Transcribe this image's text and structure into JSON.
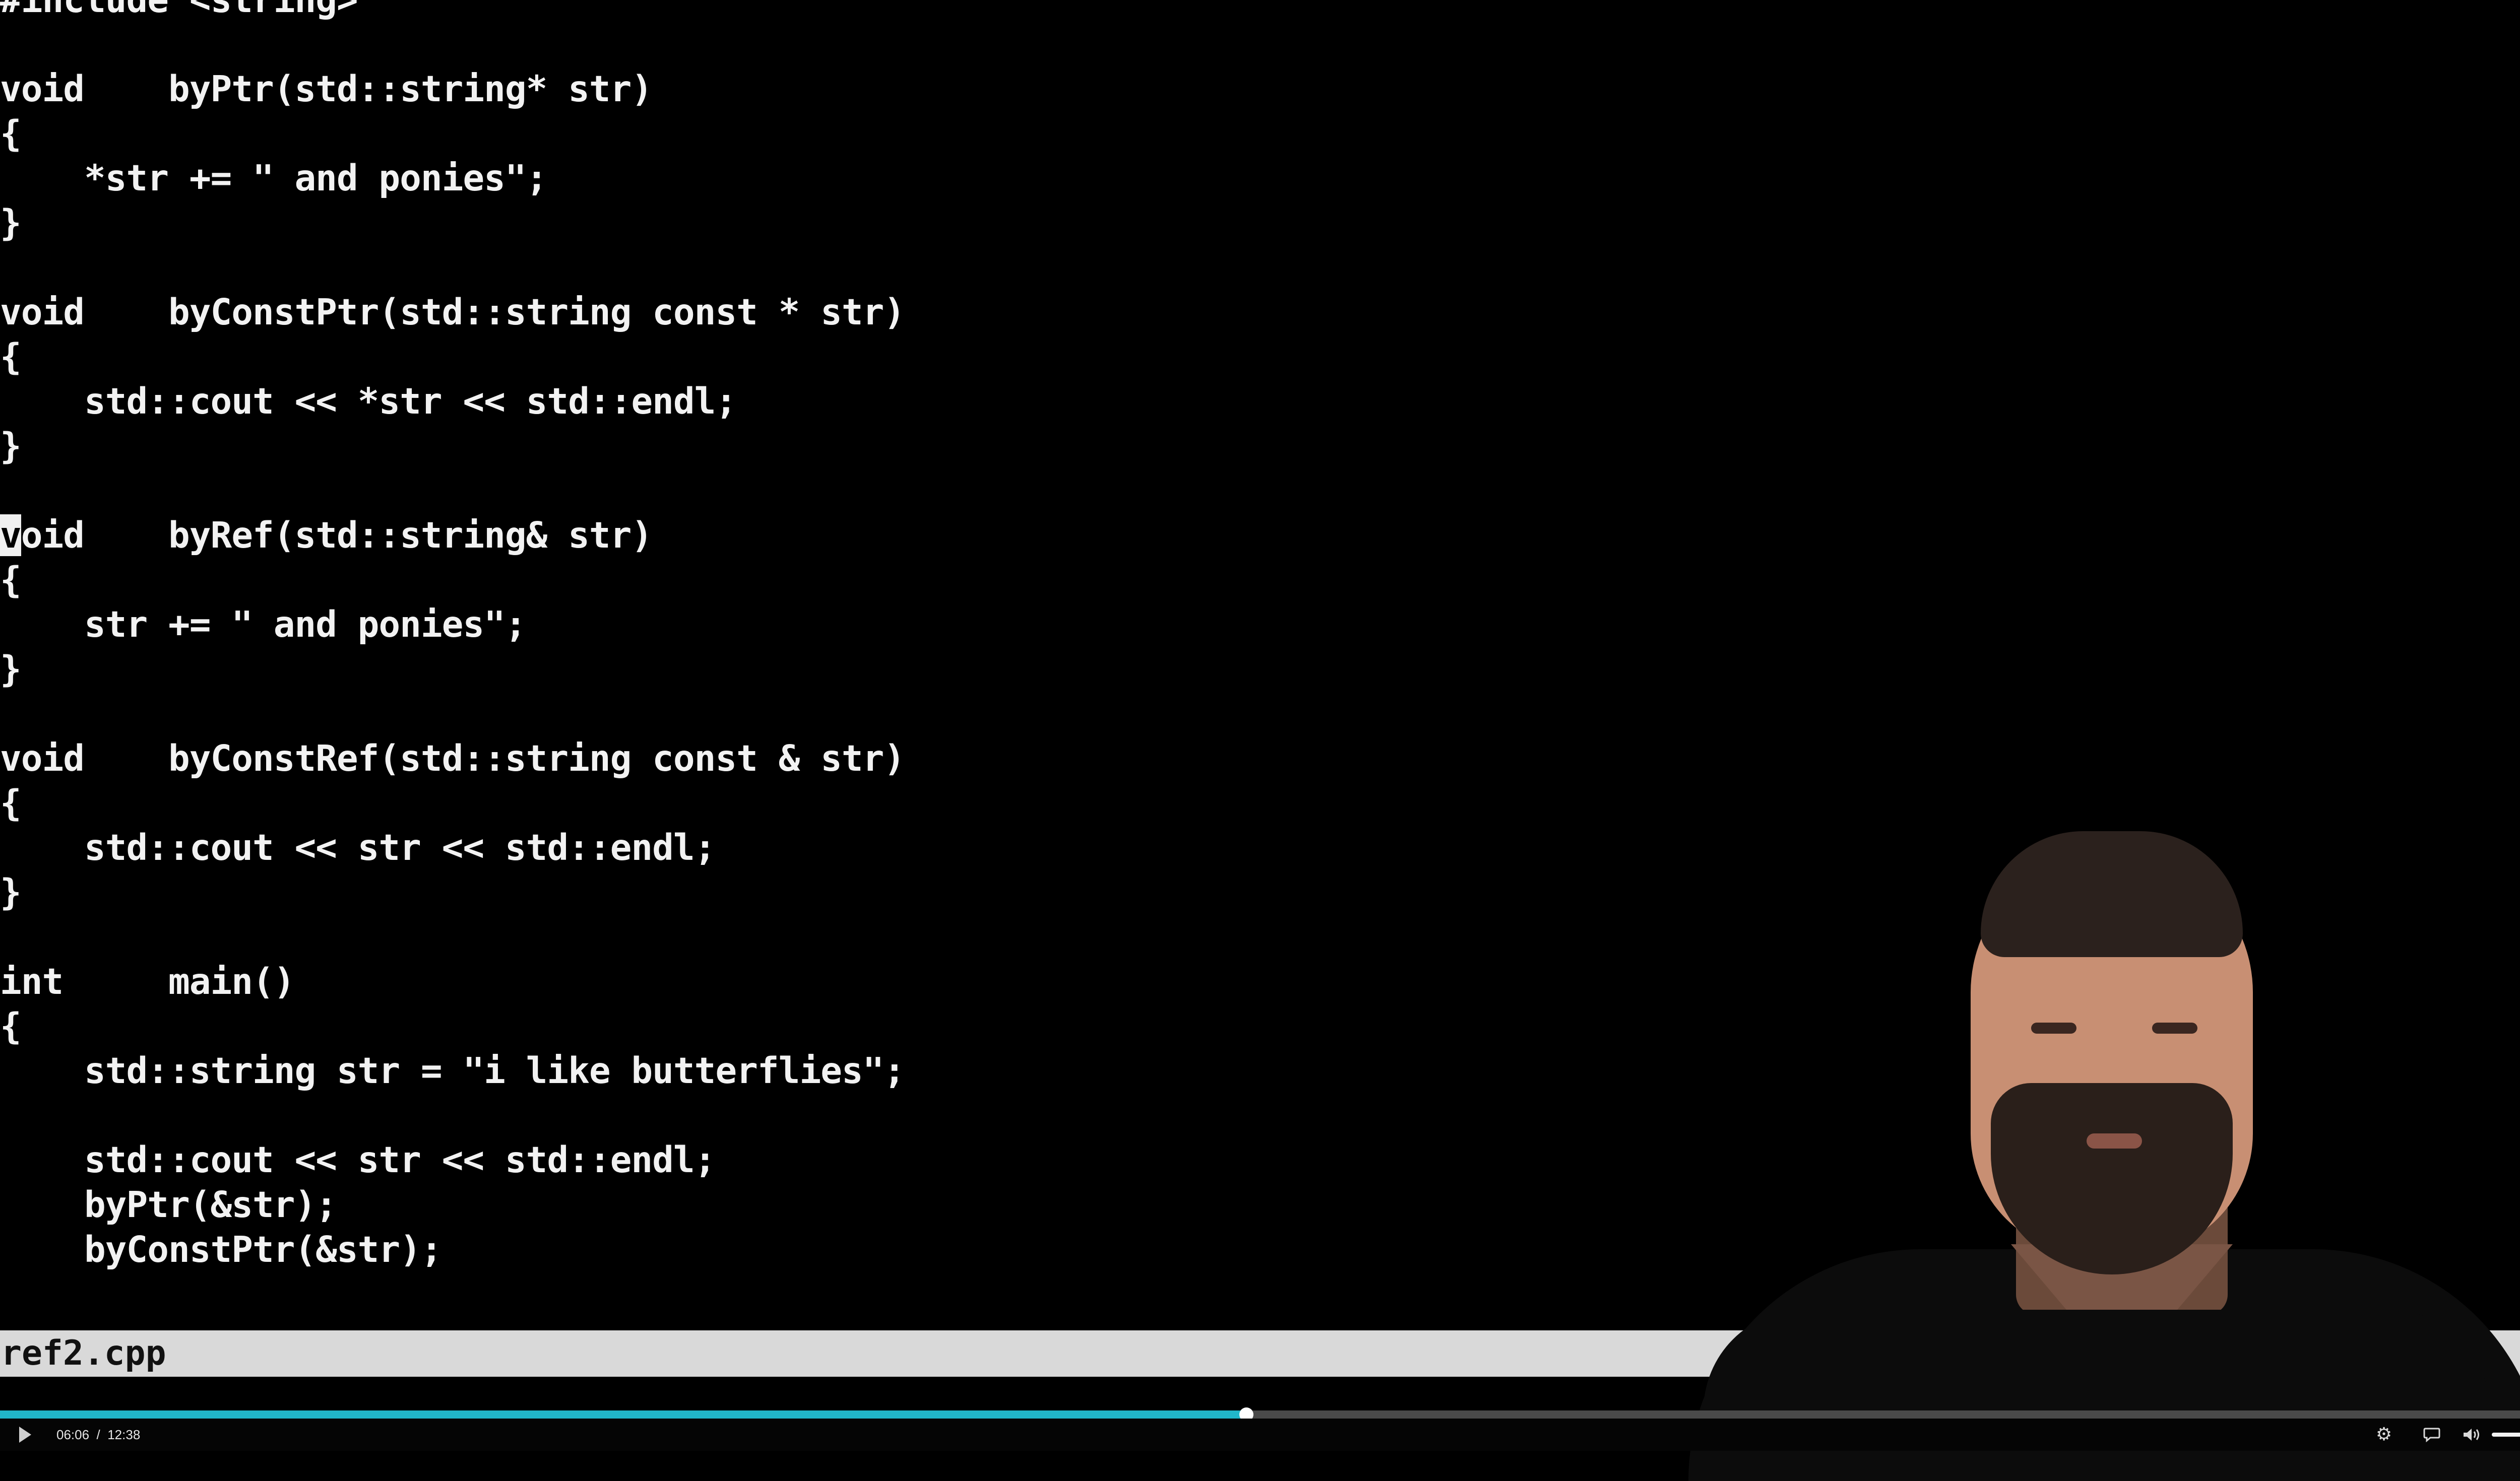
{
  "editor": {
    "lines": [
      "#include <string>",
      "",
      "void    byPtr(std::string* str)",
      "{",
      "    *str += \" and ponies\";",
      "}",
      "",
      "void    byConstPtr(std::string const * str)",
      "{",
      "    std::cout << *str << std::endl;",
      "}",
      "",
      "void    byRef(std::string& str)",
      "{",
      "    str += \" and ponies\";",
      "}",
      "",
      "void    byConstRef(std::string const & str)",
      "{",
      "    std::cout << str << std::endl;",
      "}",
      "",
      "int     main()",
      "{",
      "    std::string str = \"i like butterflies\";",
      "",
      "    std::cout << str << std::endl;",
      "    byPtr(&str);",
      "    byConstPtr(&str);"
    ],
    "cursor_line_index": 12,
    "cursor_char": "v",
    "cursor_line_rest": "oid    byRef(std::string& str)"
  },
  "statusbar": {
    "filename": "ref2.cpp"
  },
  "player": {
    "current_time": "06:06",
    "separator": "/",
    "duration": "12:38",
    "progress_fraction": 0.483,
    "volume_fraction": 0.85,
    "icons": {
      "play": "play-icon",
      "settings": "settings-gear-icon",
      "captions": "captions-bubble-icon",
      "volume": "volume-icon",
      "fullscreen": "fullscreen-icon"
    },
    "accent_color": "#21b6c9"
  }
}
